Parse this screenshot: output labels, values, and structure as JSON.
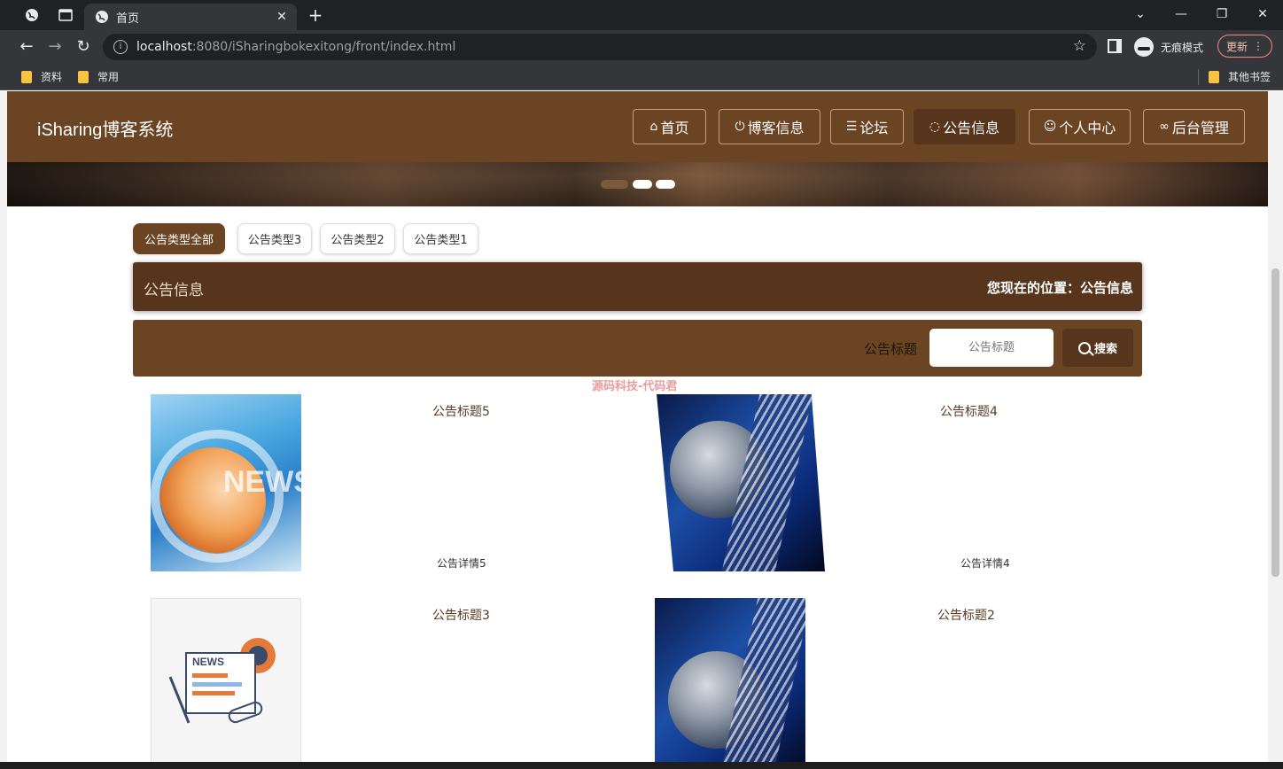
{
  "browser": {
    "tab_title": "首页",
    "url_host": "localhost",
    "url_rest": ":8080/iSharingbokexitong/front/index.html",
    "incognito_label": "无痕模式",
    "update_label": "更新",
    "bookmarks": [
      "资料",
      "常用"
    ],
    "other_bookmarks": "其他书签"
  },
  "site": {
    "title": "iSharing博客系统",
    "nav": [
      {
        "label": "首页",
        "icon": "home-icon"
      },
      {
        "label": "博客信息",
        "icon": "power-icon"
      },
      {
        "label": "论坛",
        "icon": "sliders-icon"
      },
      {
        "label": "公告信息",
        "icon": "chat-icon"
      },
      {
        "label": "个人中心",
        "icon": "user-icon"
      },
      {
        "label": "后台管理",
        "icon": "link-icon"
      }
    ],
    "active_nav": "公告信息"
  },
  "categories": [
    "公告类型全部",
    "公告类型3",
    "公告类型2",
    "公告类型1"
  ],
  "position_bar": {
    "title": "公告信息",
    "location": "您现在的位置：公告信息"
  },
  "search": {
    "label": "公告标题",
    "placeholder": "公告标题",
    "button": "搜索"
  },
  "watermark": "源码科技-代码君",
  "notices": [
    {
      "title": "公告标题5",
      "detail": "公告详情5"
    },
    {
      "title": "公告标题4",
      "detail": "公告详情4"
    },
    {
      "title": "公告标题3",
      "detail": ""
    },
    {
      "title": "公告标题2",
      "detail": ""
    }
  ],
  "colors": {
    "header": "#6b4523",
    "accent_dark": "#57351c"
  }
}
